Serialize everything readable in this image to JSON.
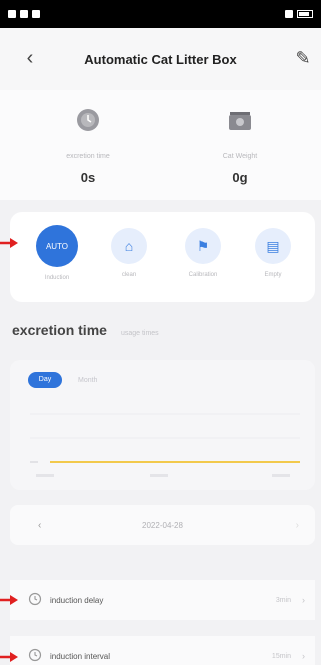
{
  "header": {
    "title": "Automatic Cat Litter Box"
  },
  "stats": {
    "left": {
      "label": "excretion time",
      "value": "0s",
      "icon": "clock-icon"
    },
    "right": {
      "label": "Cat Weight",
      "value": "0g",
      "icon": "scale-icon"
    }
  },
  "modes": [
    {
      "label": "Induction",
      "icon": "auto-icon",
      "badge": "AUTO",
      "active": true
    },
    {
      "label": "clean",
      "icon": "home-icon",
      "active": false
    },
    {
      "label": "Calibration",
      "icon": "flag-icon",
      "active": false
    },
    {
      "label": "Empty",
      "icon": "clipboard-icon",
      "active": false
    }
  ],
  "section": {
    "main_tab": "excretion time",
    "sub_tab": "usage times"
  },
  "chart": {
    "period_active": "Day",
    "period_other": "Month"
  },
  "date": {
    "value": "2022-04-28",
    "prev": "‹",
    "next": "›"
  },
  "settings": [
    {
      "label": "induction delay",
      "value": "3min",
      "icon": "timer-icon"
    },
    {
      "label": "induction interval",
      "value": "15min",
      "icon": "timer-icon"
    }
  ],
  "colors": {
    "accent": "#2f74db",
    "chart_line": "#f2c94c",
    "arrow": "#e02020"
  }
}
